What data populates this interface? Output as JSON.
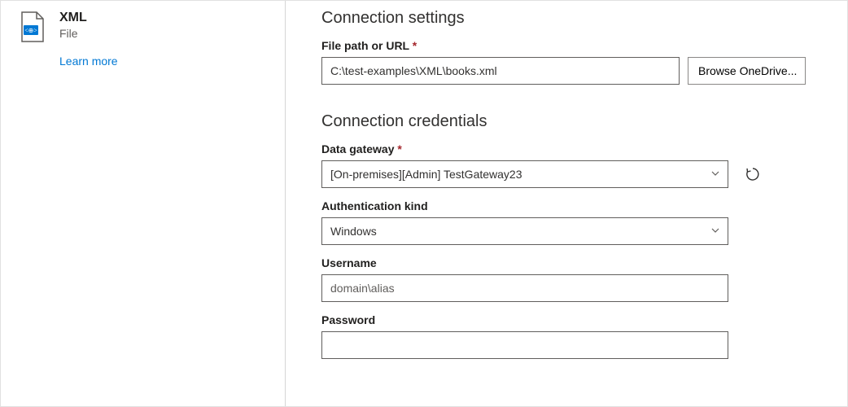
{
  "sidebar": {
    "connector_title": "XML",
    "connector_subtitle": "File",
    "learn_more": "Learn more"
  },
  "settings": {
    "heading": "Connection settings",
    "filepath_label": "File path or URL",
    "filepath_value": "C:\\test-examples\\XML\\books.xml",
    "browse_label": "Browse OneDrive..."
  },
  "credentials": {
    "heading": "Connection credentials",
    "gateway_label": "Data gateway",
    "gateway_value": "[On-premises][Admin] TestGateway23",
    "authkind_label": "Authentication kind",
    "authkind_value": "Windows",
    "username_label": "Username",
    "username_placeholder": "domain\\alias",
    "username_value": "",
    "password_label": "Password",
    "password_value": ""
  }
}
